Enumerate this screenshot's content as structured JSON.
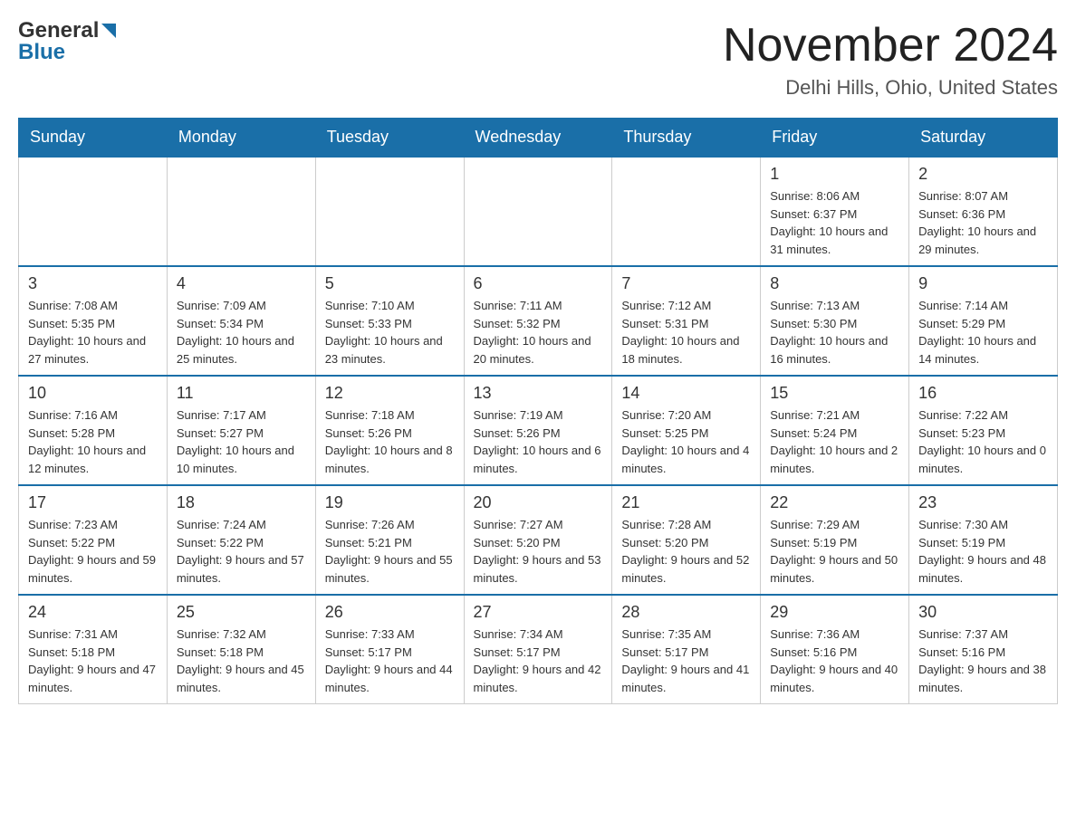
{
  "header": {
    "logo_general": "General",
    "logo_blue": "Blue",
    "month_title": "November 2024",
    "location": "Delhi Hills, Ohio, United States"
  },
  "weekdays": [
    "Sunday",
    "Monday",
    "Tuesday",
    "Wednesday",
    "Thursday",
    "Friday",
    "Saturday"
  ],
  "weeks": [
    [
      {
        "day": "",
        "sunrise": "",
        "sunset": "",
        "daylight": ""
      },
      {
        "day": "",
        "sunrise": "",
        "sunset": "",
        "daylight": ""
      },
      {
        "day": "",
        "sunrise": "",
        "sunset": "",
        "daylight": ""
      },
      {
        "day": "",
        "sunrise": "",
        "sunset": "",
        "daylight": ""
      },
      {
        "day": "",
        "sunrise": "",
        "sunset": "",
        "daylight": ""
      },
      {
        "day": "1",
        "sunrise": "Sunrise: 8:06 AM",
        "sunset": "Sunset: 6:37 PM",
        "daylight": "Daylight: 10 hours and 31 minutes."
      },
      {
        "day": "2",
        "sunrise": "Sunrise: 8:07 AM",
        "sunset": "Sunset: 6:36 PM",
        "daylight": "Daylight: 10 hours and 29 minutes."
      }
    ],
    [
      {
        "day": "3",
        "sunrise": "Sunrise: 7:08 AM",
        "sunset": "Sunset: 5:35 PM",
        "daylight": "Daylight: 10 hours and 27 minutes."
      },
      {
        "day": "4",
        "sunrise": "Sunrise: 7:09 AM",
        "sunset": "Sunset: 5:34 PM",
        "daylight": "Daylight: 10 hours and 25 minutes."
      },
      {
        "day": "5",
        "sunrise": "Sunrise: 7:10 AM",
        "sunset": "Sunset: 5:33 PM",
        "daylight": "Daylight: 10 hours and 23 minutes."
      },
      {
        "day": "6",
        "sunrise": "Sunrise: 7:11 AM",
        "sunset": "Sunset: 5:32 PM",
        "daylight": "Daylight: 10 hours and 20 minutes."
      },
      {
        "day": "7",
        "sunrise": "Sunrise: 7:12 AM",
        "sunset": "Sunset: 5:31 PM",
        "daylight": "Daylight: 10 hours and 18 minutes."
      },
      {
        "day": "8",
        "sunrise": "Sunrise: 7:13 AM",
        "sunset": "Sunset: 5:30 PM",
        "daylight": "Daylight: 10 hours and 16 minutes."
      },
      {
        "day": "9",
        "sunrise": "Sunrise: 7:14 AM",
        "sunset": "Sunset: 5:29 PM",
        "daylight": "Daylight: 10 hours and 14 minutes."
      }
    ],
    [
      {
        "day": "10",
        "sunrise": "Sunrise: 7:16 AM",
        "sunset": "Sunset: 5:28 PM",
        "daylight": "Daylight: 10 hours and 12 minutes."
      },
      {
        "day": "11",
        "sunrise": "Sunrise: 7:17 AM",
        "sunset": "Sunset: 5:27 PM",
        "daylight": "Daylight: 10 hours and 10 minutes."
      },
      {
        "day": "12",
        "sunrise": "Sunrise: 7:18 AM",
        "sunset": "Sunset: 5:26 PM",
        "daylight": "Daylight: 10 hours and 8 minutes."
      },
      {
        "day": "13",
        "sunrise": "Sunrise: 7:19 AM",
        "sunset": "Sunset: 5:26 PM",
        "daylight": "Daylight: 10 hours and 6 minutes."
      },
      {
        "day": "14",
        "sunrise": "Sunrise: 7:20 AM",
        "sunset": "Sunset: 5:25 PM",
        "daylight": "Daylight: 10 hours and 4 minutes."
      },
      {
        "day": "15",
        "sunrise": "Sunrise: 7:21 AM",
        "sunset": "Sunset: 5:24 PM",
        "daylight": "Daylight: 10 hours and 2 minutes."
      },
      {
        "day": "16",
        "sunrise": "Sunrise: 7:22 AM",
        "sunset": "Sunset: 5:23 PM",
        "daylight": "Daylight: 10 hours and 0 minutes."
      }
    ],
    [
      {
        "day": "17",
        "sunrise": "Sunrise: 7:23 AM",
        "sunset": "Sunset: 5:22 PM",
        "daylight": "Daylight: 9 hours and 59 minutes."
      },
      {
        "day": "18",
        "sunrise": "Sunrise: 7:24 AM",
        "sunset": "Sunset: 5:22 PM",
        "daylight": "Daylight: 9 hours and 57 minutes."
      },
      {
        "day": "19",
        "sunrise": "Sunrise: 7:26 AM",
        "sunset": "Sunset: 5:21 PM",
        "daylight": "Daylight: 9 hours and 55 minutes."
      },
      {
        "day": "20",
        "sunrise": "Sunrise: 7:27 AM",
        "sunset": "Sunset: 5:20 PM",
        "daylight": "Daylight: 9 hours and 53 minutes."
      },
      {
        "day": "21",
        "sunrise": "Sunrise: 7:28 AM",
        "sunset": "Sunset: 5:20 PM",
        "daylight": "Daylight: 9 hours and 52 minutes."
      },
      {
        "day": "22",
        "sunrise": "Sunrise: 7:29 AM",
        "sunset": "Sunset: 5:19 PM",
        "daylight": "Daylight: 9 hours and 50 minutes."
      },
      {
        "day": "23",
        "sunrise": "Sunrise: 7:30 AM",
        "sunset": "Sunset: 5:19 PM",
        "daylight": "Daylight: 9 hours and 48 minutes."
      }
    ],
    [
      {
        "day": "24",
        "sunrise": "Sunrise: 7:31 AM",
        "sunset": "Sunset: 5:18 PM",
        "daylight": "Daylight: 9 hours and 47 minutes."
      },
      {
        "day": "25",
        "sunrise": "Sunrise: 7:32 AM",
        "sunset": "Sunset: 5:18 PM",
        "daylight": "Daylight: 9 hours and 45 minutes."
      },
      {
        "day": "26",
        "sunrise": "Sunrise: 7:33 AM",
        "sunset": "Sunset: 5:17 PM",
        "daylight": "Daylight: 9 hours and 44 minutes."
      },
      {
        "day": "27",
        "sunrise": "Sunrise: 7:34 AM",
        "sunset": "Sunset: 5:17 PM",
        "daylight": "Daylight: 9 hours and 42 minutes."
      },
      {
        "day": "28",
        "sunrise": "Sunrise: 7:35 AM",
        "sunset": "Sunset: 5:17 PM",
        "daylight": "Daylight: 9 hours and 41 minutes."
      },
      {
        "day": "29",
        "sunrise": "Sunrise: 7:36 AM",
        "sunset": "Sunset: 5:16 PM",
        "daylight": "Daylight: 9 hours and 40 minutes."
      },
      {
        "day": "30",
        "sunrise": "Sunrise: 7:37 AM",
        "sunset": "Sunset: 5:16 PM",
        "daylight": "Daylight: 9 hours and 38 minutes."
      }
    ]
  ]
}
